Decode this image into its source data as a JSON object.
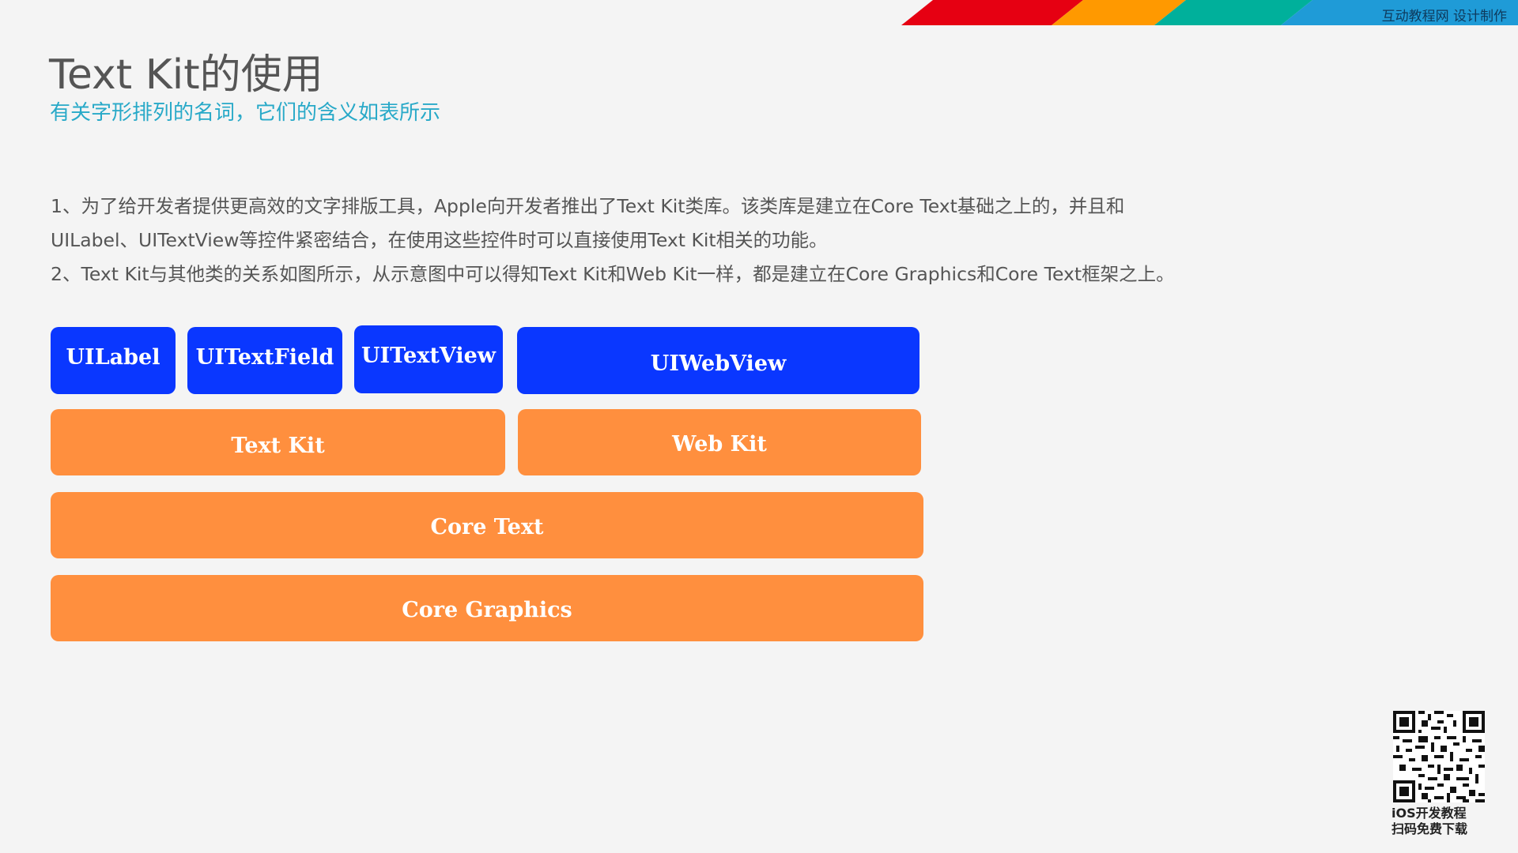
{
  "banner": {
    "credit": "互动教程网 设计制作",
    "colors": [
      "#e60012",
      "#ff9900",
      "#00b09b",
      "#1f9bd7"
    ]
  },
  "header": {
    "title": "Text Kit的使用",
    "subtitle": "有关字形排列的名词，它们的含义如表所示"
  },
  "body": {
    "lines": [
      "1、为了给开发者提供更高效的文字排版工具，Apple向开发者推出了Text Kit类库。该类库是建立在Core Text基础之上的，并且和",
      "UILabel、UITextView等控件紧密结合，在使用这些控件时可以直接使用Text Kit相关的功能。",
      "2、Text Kit与其他类的关系如图所示，从示意图中可以得知Text Kit和Web Kit一样，都是建立在Core Graphics和Core Text框架之上。"
    ]
  },
  "diagram": {
    "colors": {
      "ui_layer": "#0a37ff",
      "framework_layer": "#ff8f3e"
    },
    "ui_layer": [
      "UILabel",
      "UITextField",
      "UITextView",
      "UIWebView"
    ],
    "kits": [
      "Text Kit",
      "Web Kit"
    ],
    "core_text": "Core Text",
    "core_graphics": "Core Graphics"
  },
  "qr": {
    "caption_line1": "iOS开发教程",
    "caption_line2": "扫码免费下载"
  }
}
